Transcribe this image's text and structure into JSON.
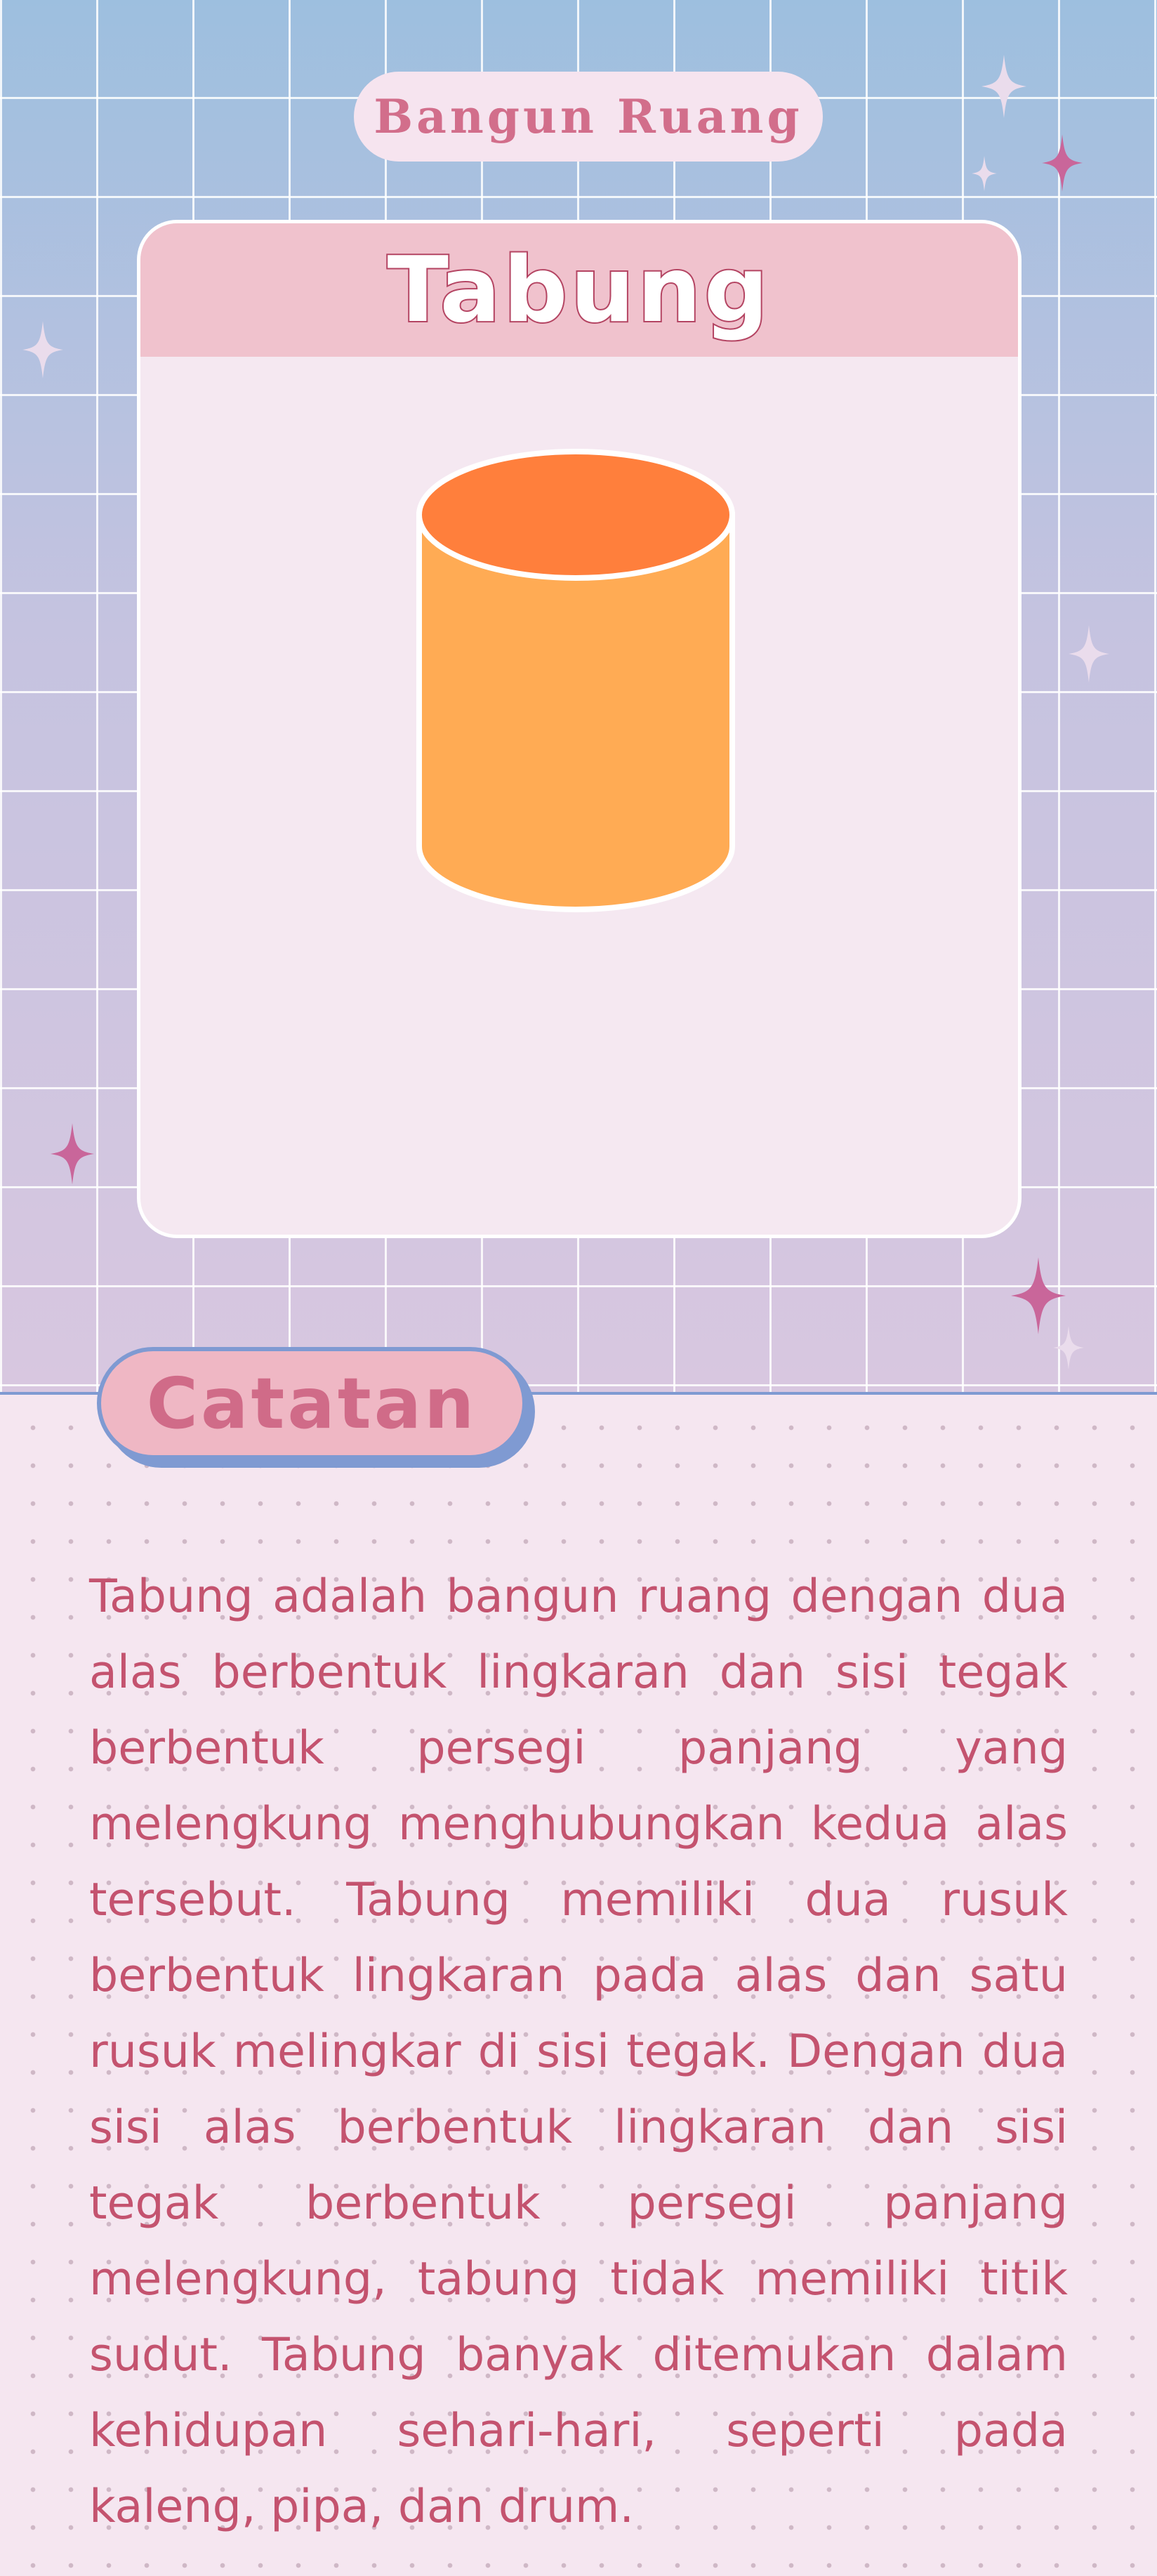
{
  "header": {
    "pill_label": "Bangun Ruang"
  },
  "card": {
    "title": "Tabung"
  },
  "notes": {
    "label": "Catatan",
    "text": "Tabung adalah bangun ruang dengan dua alas berbentuk lingkaran dan sisi tegak berbentuk persegi panjang yang melengkung menghubungkan kedua alas tersebut. Tabung memiliki dua rusuk berbentuk lingkaran pada alas dan satu rusuk melingkar di sisi tegak. Dengan dua sisi alas berbentuk lingkaran dan sisi tegak berbentuk persegi panjang melengkung, tabung tidak memiliki titik sudut. Tabung banyak ditemukan dalam kehidupan sehari-hari, seperti pada kaleng, pipa, dan drum."
  },
  "colors": {
    "accent_pink": "#c4536f",
    "cylinder_top": "#ff7f3c",
    "cylinder_body": "#ffab54",
    "border_blue": "#7f9ad2"
  }
}
